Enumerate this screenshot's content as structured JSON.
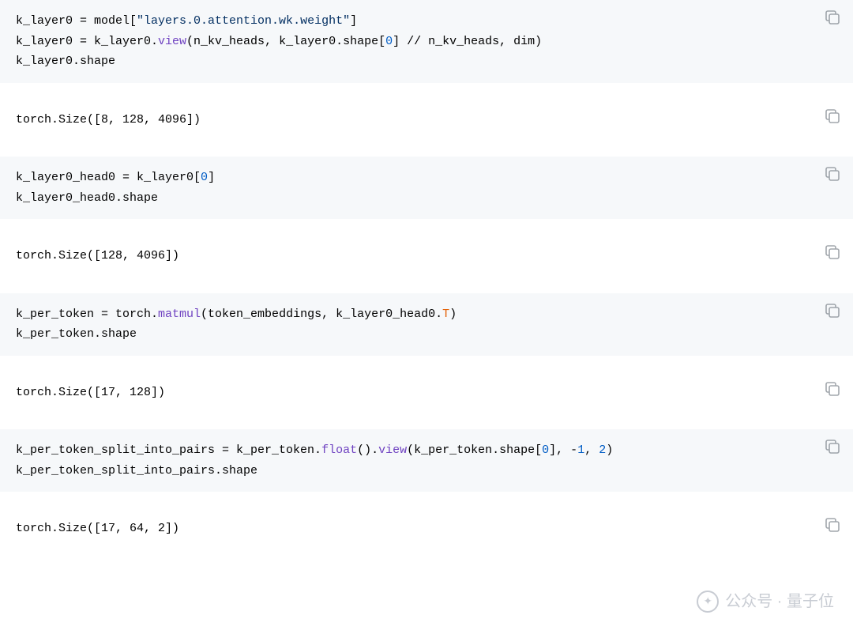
{
  "cells": [
    {
      "kind": "code",
      "tokens": [
        [
          {
            "t": "k_layer0 = model["
          },
          {
            "t": "\"layers.0.attention.wk.weight\"",
            "c": "tk-str"
          },
          {
            "t": "]"
          }
        ],
        [
          {
            "t": "k_layer0 = k_layer0."
          },
          {
            "t": "view",
            "c": "tk-fn"
          },
          {
            "t": "(n_kv_heads, k_layer0.shape["
          },
          {
            "t": "0",
            "c": "tk-num"
          },
          {
            "t": "] // n_kv_heads, dim)"
          }
        ],
        [
          {
            "t": "k_layer0.shape"
          }
        ]
      ]
    },
    {
      "kind": "output",
      "tokens": [
        [
          {
            "t": "torch.Size([8, 128, 4096])"
          }
        ]
      ]
    },
    {
      "kind": "code",
      "tokens": [
        [
          {
            "t": "k_layer0_head0 = k_layer0["
          },
          {
            "t": "0",
            "c": "tk-num"
          },
          {
            "t": "]"
          }
        ],
        [
          {
            "t": "k_layer0_head0.shape"
          }
        ]
      ]
    },
    {
      "kind": "output",
      "tokens": [
        [
          {
            "t": "torch.Size([128, 4096])"
          }
        ]
      ]
    },
    {
      "kind": "code",
      "tokens": [
        [
          {
            "t": "k_per_token = torch."
          },
          {
            "t": "matmul",
            "c": "tk-fn"
          },
          {
            "t": "(token_embeddings, k_layer0_head0."
          },
          {
            "t": "T",
            "c": "tk-attr"
          },
          {
            "t": ")"
          }
        ],
        [
          {
            "t": "k_per_token.shape"
          }
        ]
      ]
    },
    {
      "kind": "output",
      "tokens": [
        [
          {
            "t": "torch.Size([17, 128])"
          }
        ]
      ]
    },
    {
      "kind": "code",
      "tokens": [
        [
          {
            "t": "k_per_token_split_into_pairs = k_per_token."
          },
          {
            "t": "float",
            "c": "tk-fn"
          },
          {
            "t": "()."
          },
          {
            "t": "view",
            "c": "tk-fn"
          },
          {
            "t": "(k_per_token.shape["
          },
          {
            "t": "0",
            "c": "tk-num"
          },
          {
            "t": "], -"
          },
          {
            "t": "1",
            "c": "tk-num"
          },
          {
            "t": ", "
          },
          {
            "t": "2",
            "c": "tk-num"
          },
          {
            "t": ")"
          }
        ],
        [
          {
            "t": "k_per_token_split_into_pairs.shape"
          }
        ]
      ]
    },
    {
      "kind": "output",
      "tokens": [
        [
          {
            "t": "torch.Size([17, 64, 2])"
          }
        ]
      ]
    }
  ],
  "watermark": {
    "text": "公众号 · 量子位"
  }
}
